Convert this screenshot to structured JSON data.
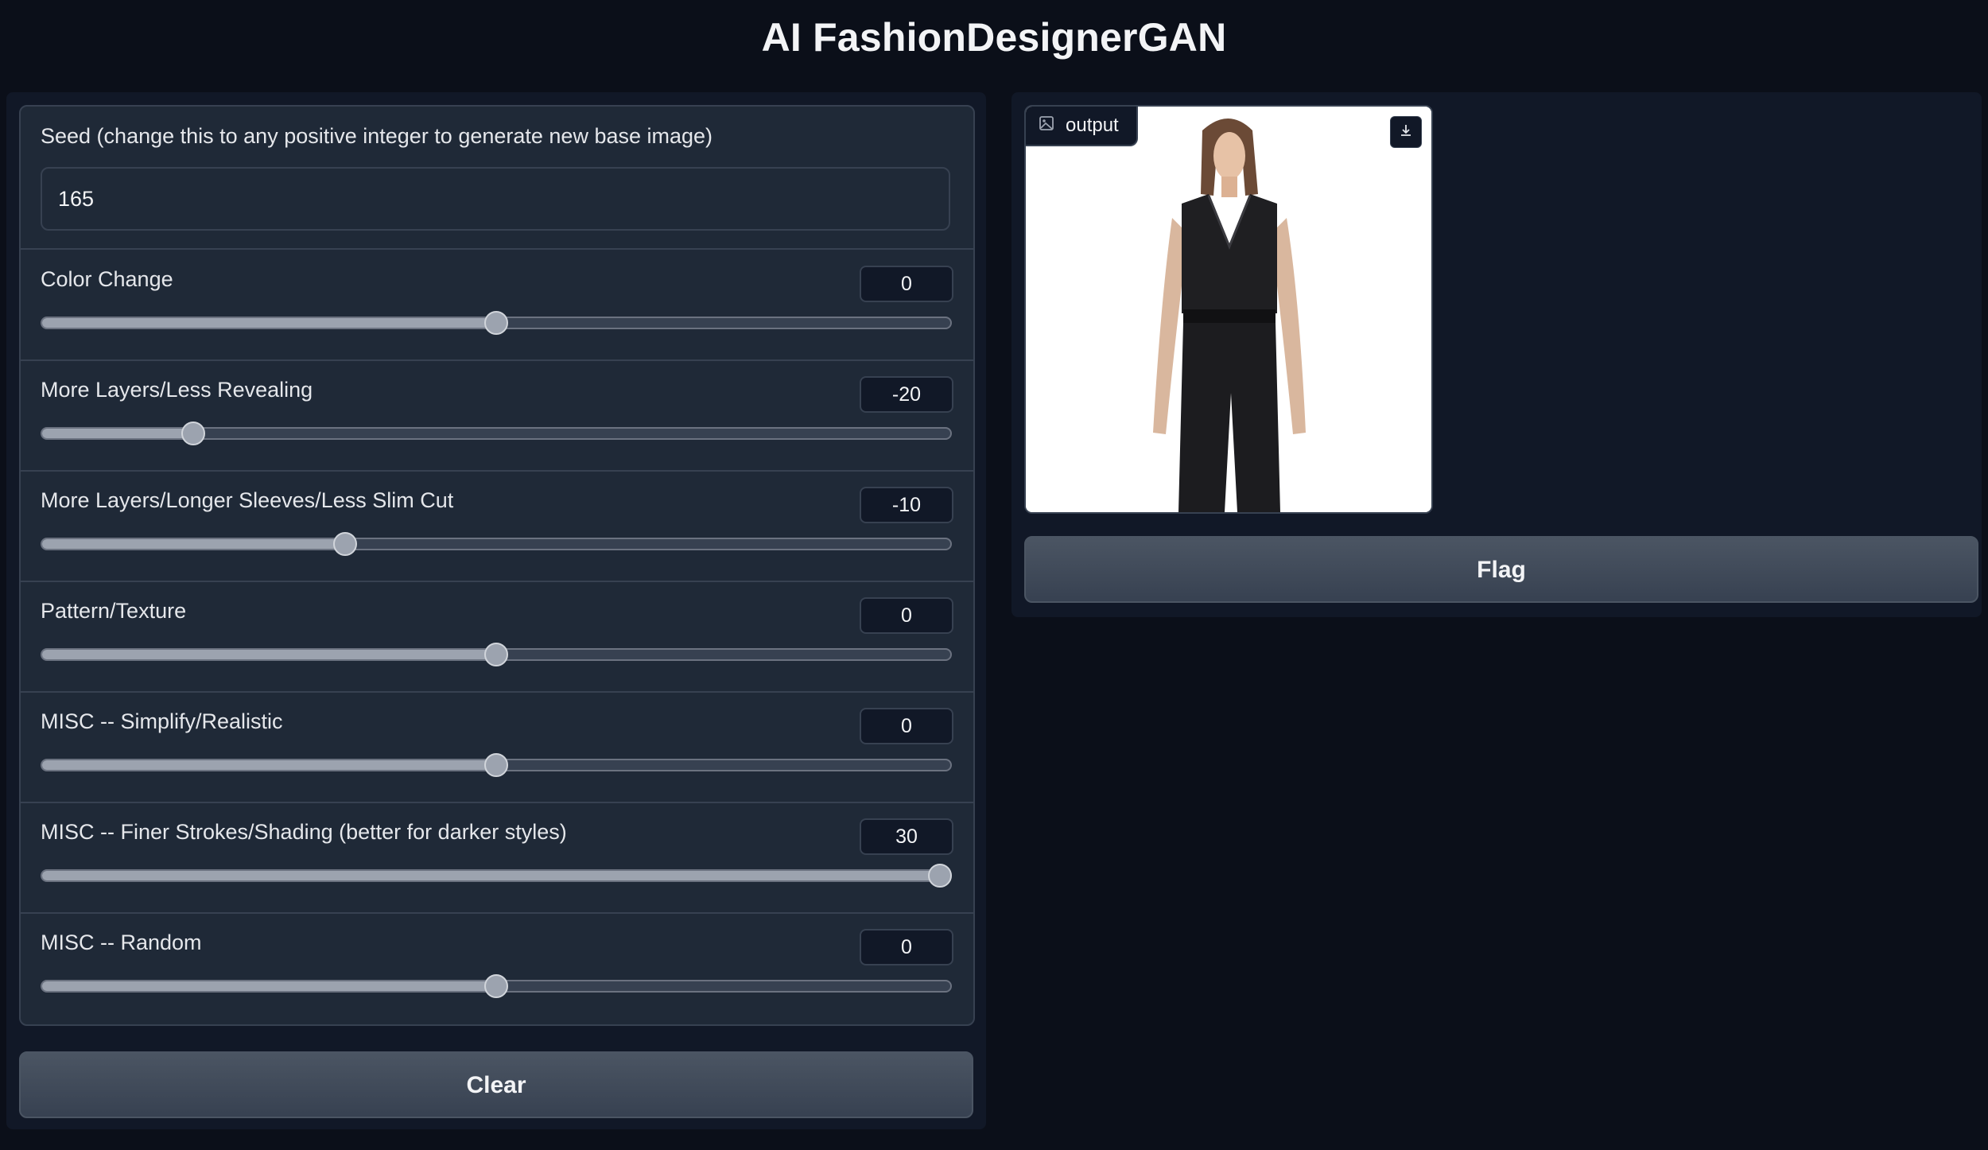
{
  "app": {
    "title": "AI FashionDesignerGAN"
  },
  "seed": {
    "label": "Seed (change this to any positive integer to generate new base image)",
    "value": "165"
  },
  "sliders": [
    {
      "label": "Color Change",
      "value": "0",
      "fraction": 0.5
    },
    {
      "label": "More Layers/Less Revealing",
      "value": "-20",
      "fraction": 0.1667
    },
    {
      "label": "More Layers/Longer Sleeves/Less Slim Cut",
      "value": "-10",
      "fraction": 0.3333
    },
    {
      "label": "Pattern/Texture",
      "value": "0",
      "fraction": 0.5
    },
    {
      "label": "MISC -- Simplify/Realistic",
      "value": "0",
      "fraction": 0.5
    },
    {
      "label": "MISC -- Finer Strokes/Shading (better for darker styles)",
      "value": "30",
      "fraction": 1.0
    },
    {
      "label": "MISC -- Random",
      "value": "0",
      "fraction": 0.5
    }
  ],
  "buttons": {
    "clear": "Clear",
    "flag": "Flag"
  },
  "output": {
    "label": "output",
    "icon": "image-icon",
    "download_icon": "download-icon"
  }
}
